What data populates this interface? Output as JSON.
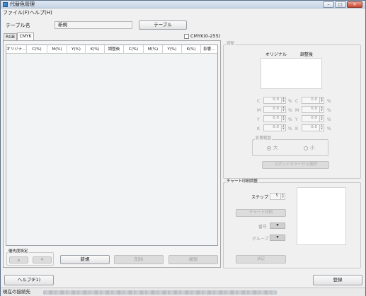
{
  "window": {
    "title": "代替色管理",
    "controls": {
      "minimize": "–",
      "maximize": "□",
      "close": "×"
    }
  },
  "menu": [
    "ファイル(F)",
    "ヘルプ(H)"
  ],
  "table_name": {
    "label": "テーブル名",
    "value": "新規",
    "button": "テーブル"
  },
  "tabs": [
    "RGB",
    "CMYK"
  ],
  "active_tab": "CMYK",
  "cmyk_range_checkbox": {
    "label": "CMYK(0-255)",
    "checked": false
  },
  "table": {
    "columns": [
      "オリジナ…",
      "C(%)",
      "M(%)",
      "Y(%)",
      "K(%)",
      "調整後",
      "C(%)",
      "M(%)",
      "Y(%)",
      "K(%)",
      "影響…"
    ],
    "rows": []
  },
  "priority": {
    "title": "優先度設定",
    "up": "▲",
    "down": "▼"
  },
  "list_buttons": {
    "new": "新規",
    "delete": "削除",
    "copy": "複製"
  },
  "adjust": {
    "title": "調整",
    "original_label": "オリジナル",
    "adjusted_label": "調整後",
    "channels": [
      {
        "label": "C",
        "original": "0.0",
        "adjusted": "0.0"
      },
      {
        "label": "M",
        "original": "0.0",
        "adjusted": "0.0"
      },
      {
        "label": "Y",
        "original": "0.0",
        "adjusted": "0.0"
      },
      {
        "label": "K",
        "original": "0.0",
        "adjusted": "0.0"
      }
    ],
    "unit": "%",
    "range": {
      "title": "影響範囲",
      "large": "大",
      "small": "小",
      "selected": "大"
    },
    "spot_button": "スポットカラーから選択"
  },
  "chart": {
    "title": "チャート印刷調整",
    "step_label": "ステップ",
    "step_value": "5",
    "print_button": "チャート印刷",
    "number_label": "番号",
    "group_label": "グループ",
    "decide_button": "決定"
  },
  "bottom": {
    "help_button": "ヘルプ(F1)",
    "register_button": "登録"
  },
  "status": {
    "label": "現在の接続先"
  },
  "colors": {
    "window_bg": "#f0f0f0",
    "grid_bg": "#f2f3f5",
    "titlebar": "#c5d4e6"
  }
}
